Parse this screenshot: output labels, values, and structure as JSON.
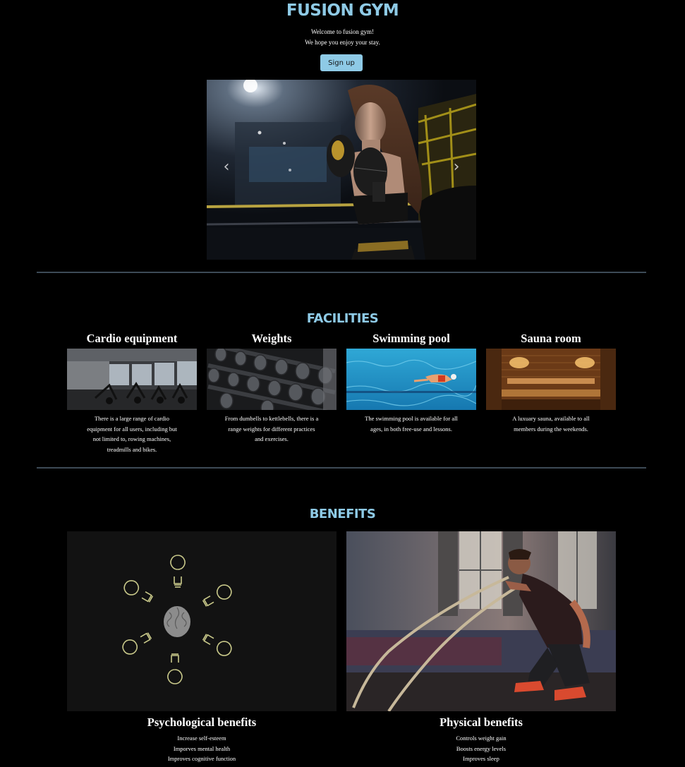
{
  "header": {
    "title": "FUSION GYM",
    "welcome_line1": "Welcome to fusion gym!",
    "welcome_line2": "We hope you enjoy your stay.",
    "signup_label": "Sign up"
  },
  "carousel": {
    "prev_icon": "chevron-left-icon",
    "next_icon": "chevron-right-icon",
    "prev_glyph": "‹",
    "next_glyph": "›"
  },
  "facilities": {
    "heading": "FACILITIES",
    "items": [
      {
        "title": "Cardio equipment",
        "description": "There is a large range of cardio equipment for all users, including but not limited to, rowing machines, treadmills and bikes."
      },
      {
        "title": "Weights",
        "description": "From dumbells to kettlebells, there is a range weights for different practices and exercises."
      },
      {
        "title": "Swimming pool",
        "description": "The swimming pool is available for all ages, in both free-use and lessons."
      },
      {
        "title": "Sauna room",
        "description": "A luxuary sauna, available to all members during the weekends."
      }
    ]
  },
  "benefits": {
    "heading": "BENEFITS",
    "items": [
      {
        "title": "Psychological benefits",
        "points": [
          "Increase self-esteem",
          "Imporves mental health",
          "Improves cognitive function"
        ]
      },
      {
        "title": "Physical benefits",
        "points": [
          "Controls weight gain",
          "Boosts energy levels",
          "Improves sleep"
        ]
      }
    ]
  },
  "colors": {
    "accent": "#8ecae6",
    "background": "#000000",
    "divider": "#3d4a56"
  }
}
